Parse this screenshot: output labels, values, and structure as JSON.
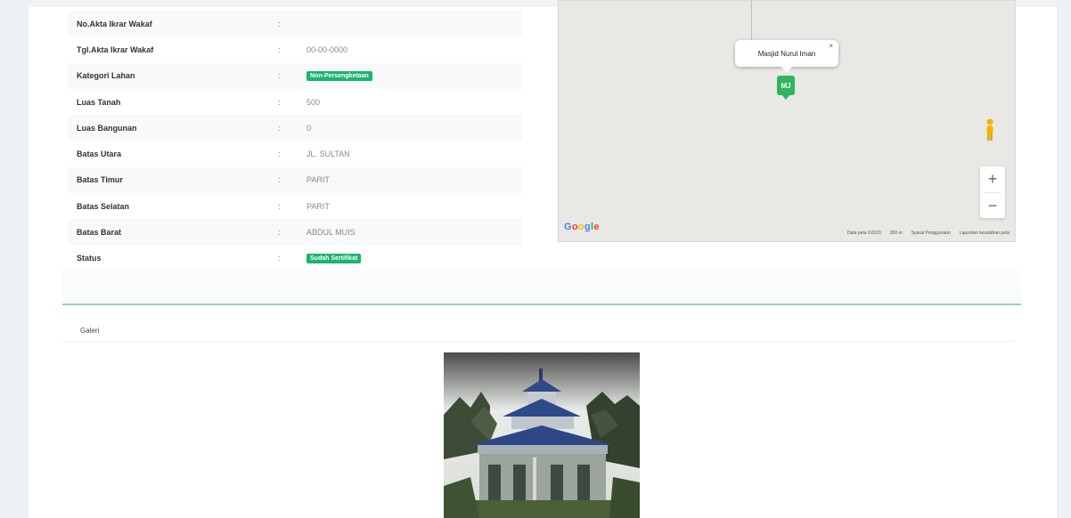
{
  "detail_rows": [
    {
      "label": "No.Akta Ikrar Wakaf",
      "value": "",
      "badge": false
    },
    {
      "label": "Tgl.Akta Ikrar Wakaf",
      "value": "00-00-0000",
      "badge": false
    },
    {
      "label": "Kategori Lahan",
      "value": "Non-Persengketaan",
      "badge": true
    },
    {
      "label": "Luas Tanah",
      "value": "500",
      "badge": false
    },
    {
      "label": "Luas Bangunan",
      "value": "0",
      "badge": false
    },
    {
      "label": "Batas Utara",
      "value": "JL. SULTAN",
      "badge": false
    },
    {
      "label": "Batas Timur",
      "value": "PARIT",
      "badge": false
    },
    {
      "label": "Batas Selatan",
      "value": "PARIT",
      "badge": false
    },
    {
      "label": "Batas Barat",
      "value": "ABDUL MUIS",
      "badge": false
    },
    {
      "label": "Status",
      "value": "Sudah Sertifikat",
      "badge": true
    }
  ],
  "separator": ":",
  "map": {
    "info_window_text": "Masjid Nurul Iman",
    "info_close": "×",
    "marker_label": "MJ",
    "zoom_in": "+",
    "zoom_out": "−",
    "google_logo": "Google",
    "attribution": [
      "Data peta ©2020",
      "200 m",
      "Syarat Penggunaan",
      "Laporkan kesalahan peta"
    ],
    "marker_color": "#2fb55b"
  },
  "gallery": {
    "header": "Galeri"
  },
  "colors": {
    "badge": "#1cb46e",
    "accent_line": "#8fd3c9"
  }
}
